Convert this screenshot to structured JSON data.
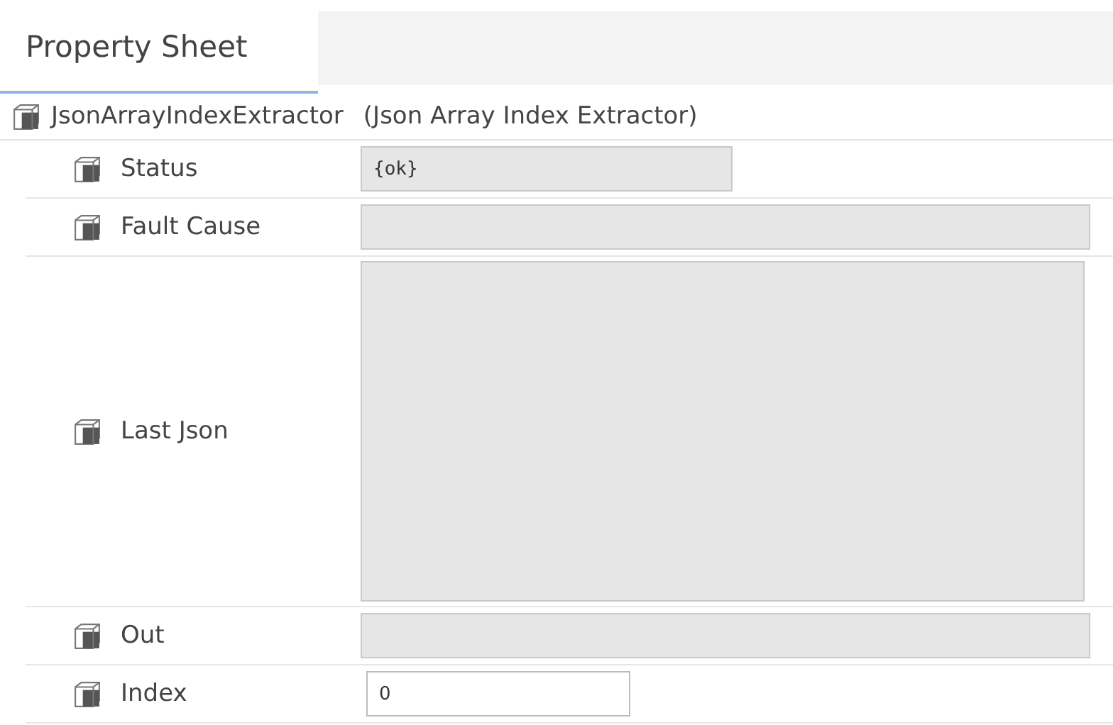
{
  "tabs": [
    {
      "label": "Property Sheet",
      "selected": true
    }
  ],
  "root": {
    "name": "JsonArrayIndexExtractor",
    "type": "(Json Array Index Extractor)"
  },
  "properties": [
    {
      "label": "Status",
      "kind": "short",
      "value": "{ok}"
    },
    {
      "label": "Fault Cause",
      "kind": "wide"
    },
    {
      "label": "Last Json",
      "kind": "tall"
    },
    {
      "label": "Out",
      "kind": "wide"
    },
    {
      "label": "Index",
      "kind": "edit",
      "value": "0"
    }
  ]
}
